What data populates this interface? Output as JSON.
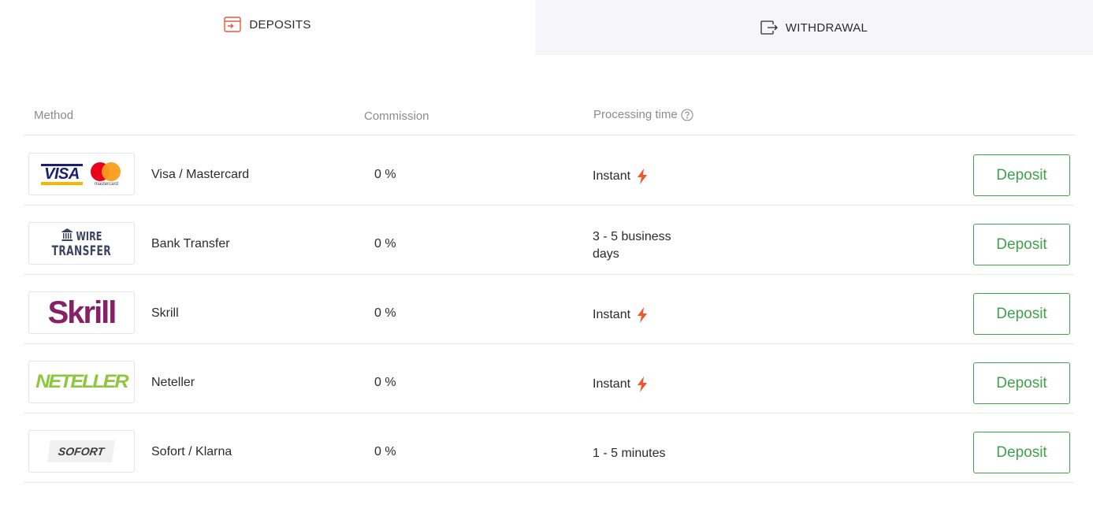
{
  "tabs": [
    {
      "label": "DEPOSITS",
      "active": true,
      "icon": "deposit-icon"
    },
    {
      "label": "WITHDRAWAL",
      "active": false,
      "icon": "withdrawal-icon"
    }
  ],
  "table": {
    "headers": {
      "method": "Method",
      "commission": "Commission",
      "processing": "Processing time"
    },
    "rows": [
      {
        "method": "Visa / Mastercard",
        "commission": "0 %",
        "processing": "Instant",
        "instant": true,
        "button": "Deposit",
        "logo": {
          "visa": "VISA",
          "mastercard": "mastercard"
        }
      },
      {
        "method": "Bank Transfer",
        "commission": "0 %",
        "processing": "3 - 5 business days",
        "instant": false,
        "button": "Deposit",
        "logo": {
          "line1": "WIRE",
          "line2": "TRANSFER"
        }
      },
      {
        "method": "Skrill",
        "commission": "0 %",
        "processing": "Instant",
        "instant": true,
        "button": "Deposit",
        "logo": {
          "text": "Skrill"
        }
      },
      {
        "method": "Neteller",
        "commission": "0 %",
        "processing": "Instant",
        "instant": true,
        "button": "Deposit",
        "logo": {
          "text": "NETELLER"
        }
      },
      {
        "method": "Sofort / Klarna",
        "commission": "0 %",
        "processing": "1 - 5 minutes",
        "instant": false,
        "button": "Deposit",
        "logo": {
          "text": "SOFORT"
        }
      }
    ]
  },
  "colors": {
    "accent_green": "#3fa14a",
    "deposit_icon": "#e9573f",
    "bolt": "#f0562d",
    "tab_inactive_bg": "#f6f6fa"
  }
}
